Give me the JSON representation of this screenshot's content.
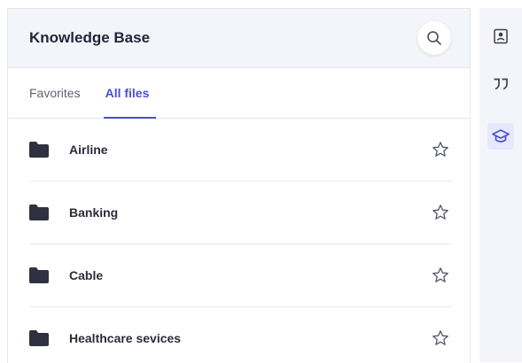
{
  "header": {
    "title": "Knowledge Base",
    "search_icon": "search-icon"
  },
  "tabs": [
    {
      "label": "Favorites",
      "active": false
    },
    {
      "label": "All files",
      "active": true
    }
  ],
  "files": [
    {
      "name": "Airline",
      "icon": "folder-icon",
      "action_icon": "star-outline-icon"
    },
    {
      "name": "Banking",
      "icon": "folder-icon",
      "action_icon": "star-outline-icon"
    },
    {
      "name": "Cable",
      "icon": "folder-icon",
      "action_icon": "star-outline-icon"
    },
    {
      "name": "Healthcare sevices",
      "icon": "folder-icon",
      "action_icon": "star-outline-icon"
    }
  ],
  "rail": [
    {
      "icon": "contact-card-icon",
      "active": false
    },
    {
      "icon": "quote-icon",
      "active": false
    },
    {
      "icon": "graduation-cap-icon",
      "active": true
    }
  ],
  "colors": {
    "accent": "#4b4fd1",
    "header_bg": "#f4f5fb",
    "folder": "#2f3140",
    "divider": "#e8e9ef"
  }
}
